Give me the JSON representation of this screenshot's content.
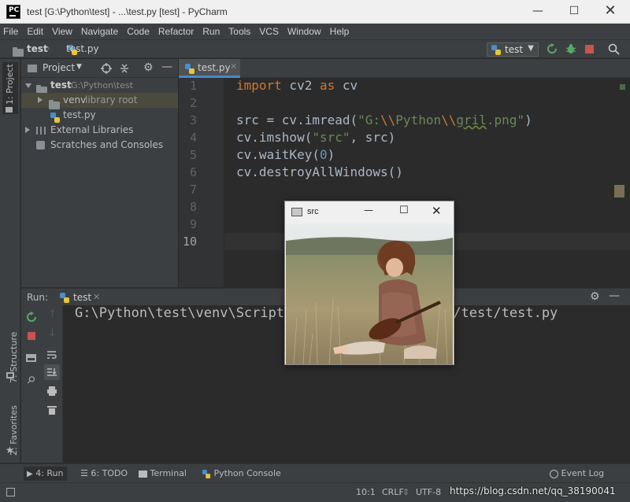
{
  "window": {
    "title": "test [G:\\Python\\test] - ...\\test.py [test] - PyCharm",
    "logo": "PC",
    "minimize_icon": "minimize-icon",
    "maximize_icon": "maximize-icon",
    "close_icon": "close-icon"
  },
  "menu": [
    "File",
    "Edit",
    "View",
    "Navigate",
    "Code",
    "Refactor",
    "Run",
    "Tools",
    "VCS",
    "Window",
    "Help"
  ],
  "navbar": {
    "project": "test",
    "file": "test.py",
    "run_config": "test"
  },
  "left_stripe": {
    "project_tab": "1: Project",
    "structure_tab": "7: Structure",
    "favorites_tab": "2: Favorites"
  },
  "project_panel": {
    "header": "Project",
    "tree": [
      {
        "label": "test",
        "hint": "G:\\Python\\test"
      },
      {
        "label": "venv",
        "hint": "library root"
      },
      {
        "label": "test.py",
        "hint": ""
      },
      {
        "label": "External Libraries",
        "hint": ""
      },
      {
        "label": "Scratches and Consoles",
        "hint": ""
      }
    ]
  },
  "editor": {
    "tab": "test.py",
    "line_numbers": [
      "1",
      "2",
      "3",
      "4",
      "5",
      "6",
      "7",
      "8",
      "9",
      "10"
    ],
    "code": {
      "l1_kw1": "import",
      "l1_mid": " cv2 ",
      "l1_kw2": "as",
      "l1_end": " cv",
      "l3_a": "src = cv.imread(",
      "l3_s1": "\"G:",
      "l3_s2": "\\\\",
      "l3_s3": "Python",
      "l3_s4": "\\\\",
      "l3_s5": "gril",
      "l3_s6": ".png\"",
      "l3_b": ")",
      "l4_a": "cv.imshow(",
      "l4_s": "\"src\"",
      "l4_b": ", src)",
      "l5_a": "cv.waitKey(",
      "l5_n": "0",
      "l5_b": ")",
      "l6": "cv.destroyAllWindows()"
    }
  },
  "run_panel": {
    "label": "Run:",
    "tab": "test",
    "output_left": "G:\\Python\\test\\venv\\Scripts",
    "output_right": "n/test/test.py"
  },
  "image_window": {
    "title": "src"
  },
  "bottom_tabs": {
    "run": "4: Run",
    "todo": "6: TODO",
    "terminal": "Terminal",
    "python_console": "Python Console",
    "event_log": "Event Log"
  },
  "status": {
    "position": "10:1",
    "line_sep": "CRLF",
    "encoding": "UTF-8",
    "watermark": "https://blog.csdn.net/qq_38190041"
  }
}
